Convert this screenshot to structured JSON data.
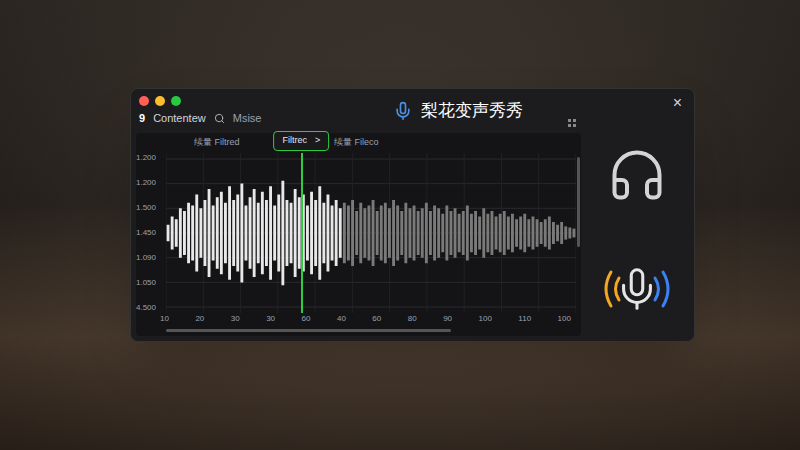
{
  "window": {
    "title": "梨花变声秀秀",
    "close": "×",
    "logo": "9",
    "app_name": "Contentew"
  },
  "window_controls": [
    {
      "color": "#ff5f57"
    },
    {
      "color": "#febc2e"
    },
    {
      "color": "#28c840"
    }
  ],
  "search": {
    "placeholder": "Msise"
  },
  "chart": {
    "labels": {
      "left": "续量 Filtred",
      "right": "续量 Fileco"
    },
    "tooltip": {
      "label": "Filtrec",
      "arrow": ">"
    },
    "y_ticks": [
      "1.200",
      "1.200",
      "1.500",
      "1.450",
      "1.090",
      "1.050",
      "4.500"
    ],
    "x_ticks": [
      "10",
      "20",
      "30",
      "30",
      "60",
      "40",
      "60",
      "80",
      "90",
      "100",
      "110",
      "100"
    ],
    "progress": 0.43,
    "cursor": 0.33,
    "waveform": [
      0.15,
      0.3,
      0.25,
      0.45,
      0.4,
      0.55,
      0.5,
      0.7,
      0.45,
      0.6,
      0.8,
      0.5,
      0.65,
      0.75,
      0.55,
      0.85,
      0.6,
      0.7,
      0.9,
      0.5,
      0.65,
      0.8,
      0.55,
      0.75,
      0.6,
      0.85,
      0.5,
      0.7,
      0.95,
      0.6,
      0.55,
      0.8,
      0.65,
      0.7,
      0.5,
      0.75,
      0.6,
      0.85,
      0.55,
      0.7,
      0.5,
      0.6,
      0.45,
      0.55,
      0.5,
      0.6,
      0.4,
      0.55,
      0.45,
      0.5,
      0.6,
      0.4,
      0.5,
      0.55,
      0.45,
      0.6,
      0.5,
      0.4,
      0.55,
      0.45,
      0.5,
      0.4,
      0.45,
      0.55,
      0.4,
      0.5,
      0.45,
      0.35,
      0.5,
      0.4,
      0.45,
      0.35,
      0.4,
      0.5,
      0.35,
      0.4,
      0.3,
      0.45,
      0.35,
      0.4,
      0.3,
      0.35,
      0.4,
      0.3,
      0.35,
      0.25,
      0.3,
      0.35,
      0.25,
      0.3,
      0.25,
      0.2,
      0.25,
      0.3,
      0.2,
      0.15,
      0.2,
      0.12,
      0.1,
      0.08
    ]
  }
}
